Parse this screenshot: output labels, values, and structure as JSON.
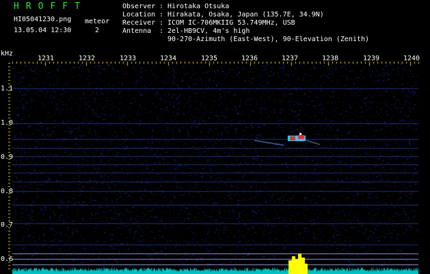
{
  "header": {
    "app_title": "HROFFT",
    "filename": "HI05041230.png",
    "timestamp": "13.05.04 12:30",
    "meteor_label": "meteor",
    "meteor_count": "2"
  },
  "station": [
    {
      "key": "Observer",
      "sep": ":",
      "value": "Hirotaka Otsuka"
    },
    {
      "key": "Location",
      "sep": ":",
      "value": "Hirakata, Osaka, Japan (135.7E, 34.9N)"
    },
    {
      "key": "Receiver",
      "sep": ":",
      "value": "ICOM IC-706MKIIG 53.749MHz, USB"
    },
    {
      "key": "Antenna",
      "sep": ":",
      "value": "2el-HB9CV, 4m's high"
    },
    {
      "key": "",
      "sep": "",
      "value": "90-270-Azimuth (East-West), 90-Elevation (Zenith)"
    }
  ],
  "spectrogram": {
    "freq_unit": "kHz",
    "x_ticks": [
      "1231",
      "1232",
      "1233",
      "1234",
      "1235",
      "1236",
      "1237",
      "1238",
      "1239",
      "1240"
    ],
    "y_ticks": [
      "1.1",
      "1.0",
      "0.9",
      "0.8",
      "0.7",
      "0.6"
    ],
    "colors": {
      "background": "#000000",
      "noise": "#1a2aa8",
      "tick": "#d8d000",
      "echo_core": "#e03030",
      "echo_halo": "#30d0ff",
      "spectrum_trace": "#00c0c0",
      "spectrum_peak": "#ffff00",
      "divider": "#c0c0ff"
    }
  }
}
